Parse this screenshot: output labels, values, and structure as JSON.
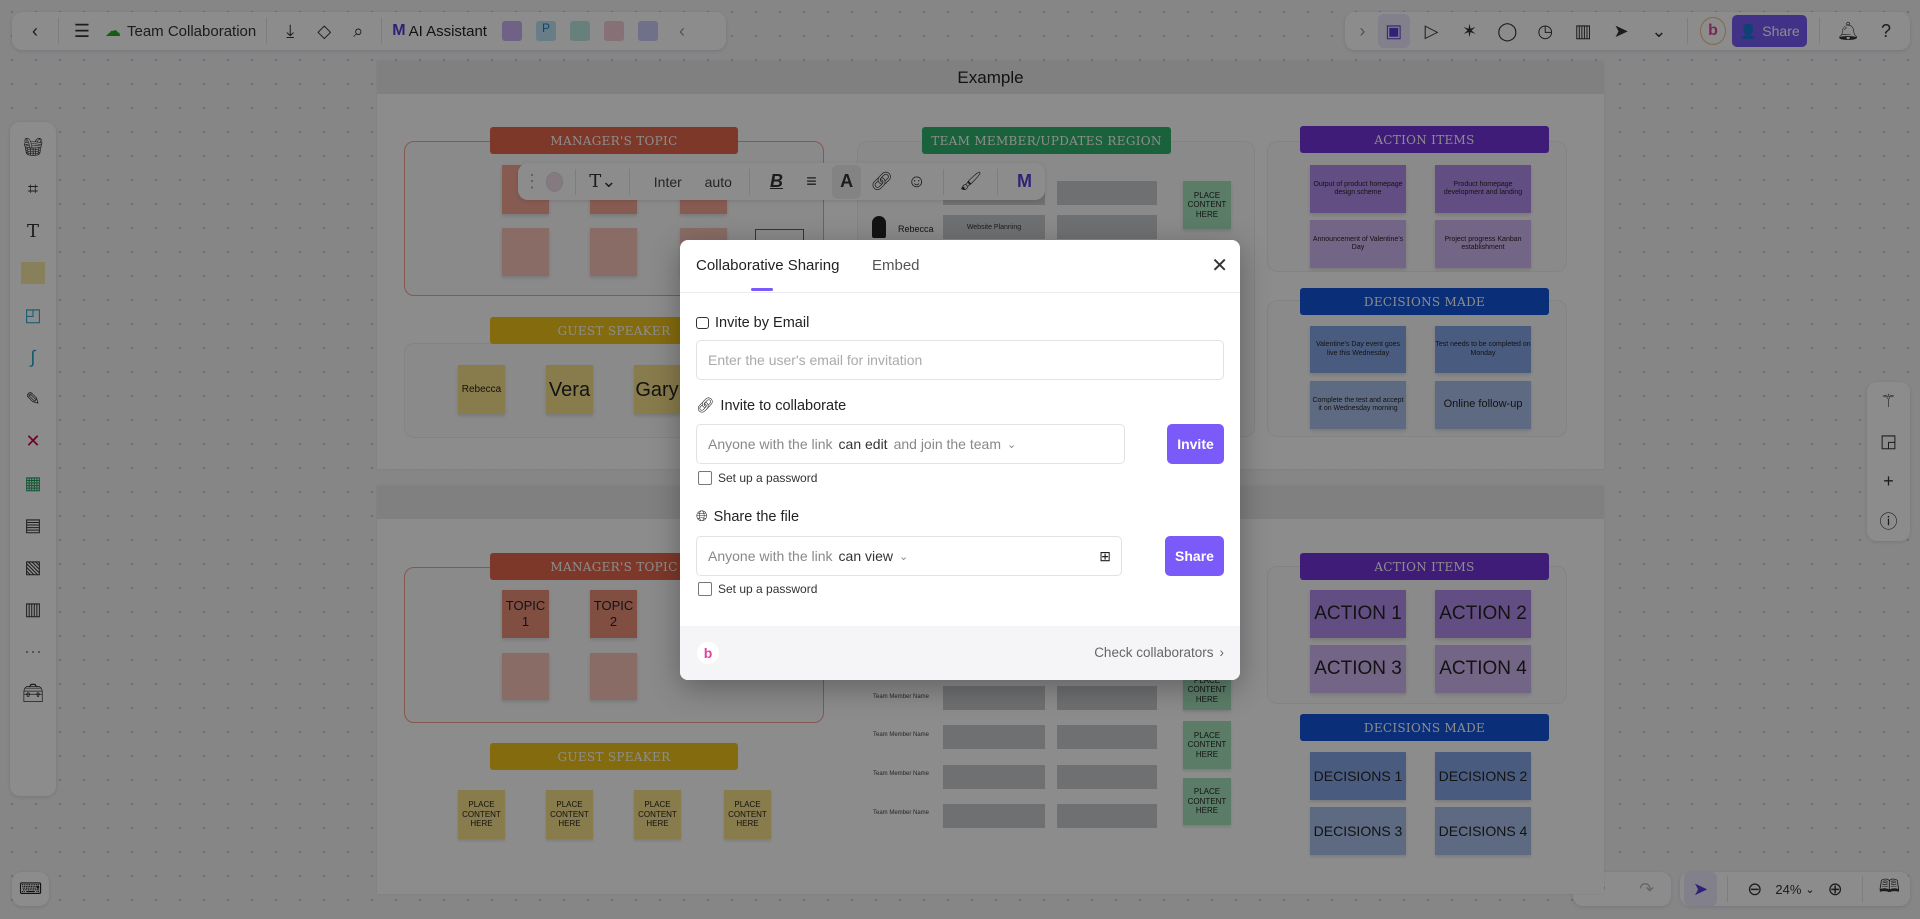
{
  "topbar": {
    "title": "Team Collaboration",
    "ai_label": "AI Assistant",
    "share_label": "Share"
  },
  "canvas": {
    "frame1": {
      "title": "Example",
      "manager_label": "MANAGER'S TOPIC",
      "team_label": "TEAM MEMBER/UPDATES REGION",
      "guest_label": "GUEST SPEAKER",
      "action_label": "ACTION ITEMS",
      "decisions_label": "DECISIONS MADE",
      "guests": [
        "Rebecca",
        "Vera",
        "Gary"
      ],
      "team_member": "Rebecca",
      "team_update": "Website Planning",
      "place": "PLACE CONTENT HERE",
      "actions": [
        "Output of product homepage design scheme",
        "Product homepage development and landing",
        "Announcement of Valentine's Day",
        "Project progress Kanban establishment"
      ],
      "decisions": [
        "Valentine's Day event goes live this Wednesday",
        "Test needs to be completed on Monday",
        "Complete the test and accept it on Wednesday morning",
        "Online follow-up"
      ]
    },
    "frame2": {
      "manager_label": "MANAGER'S TOPIC",
      "guest_label": "GUEST SPEAKER",
      "action_label": "ACTION ITEMS",
      "decisions_label": "DECISIONS MADE",
      "topics": [
        "TOPIC 1",
        "TOPIC 2"
      ],
      "place": "PLACE CONTENT HERE",
      "team_member": "Team Member Name",
      "actions": [
        "ACTION 1",
        "ACTION 2",
        "ACTION 3",
        "ACTION 4"
      ],
      "decisions": [
        "DECISIONS 1",
        "DECISIONS 2",
        "DECISIONS 3",
        "DECISIONS 4"
      ]
    }
  },
  "format_toolbar": {
    "font": "Inter",
    "size": "auto"
  },
  "zoom": {
    "level": "24%"
  },
  "modal": {
    "tabs": [
      "Collaborative Sharing",
      "Embed"
    ],
    "email_section": "Invite by Email",
    "email_placeholder": "Enter the user's email for invitation",
    "collab_section": "Invite to collaborate",
    "collab_prefix": "Anyone with the link",
    "collab_perm": "can edit",
    "collab_suffix": "and join the team",
    "invite_label": "Invite",
    "password_label": "Set up a password",
    "share_section": "Share the file",
    "share_prefix": "Anyone with the link",
    "share_perm": "can view",
    "share_label": "Share",
    "password_label2": "Set up a password",
    "check_collaborators": "Check collaborators"
  },
  "colors": {
    "accent": "#7a5af8",
    "manager": "#e5654a",
    "guest": "#f0c419",
    "team": "#2fb36b",
    "action": "#7333da",
    "decisions": "#1255da"
  }
}
